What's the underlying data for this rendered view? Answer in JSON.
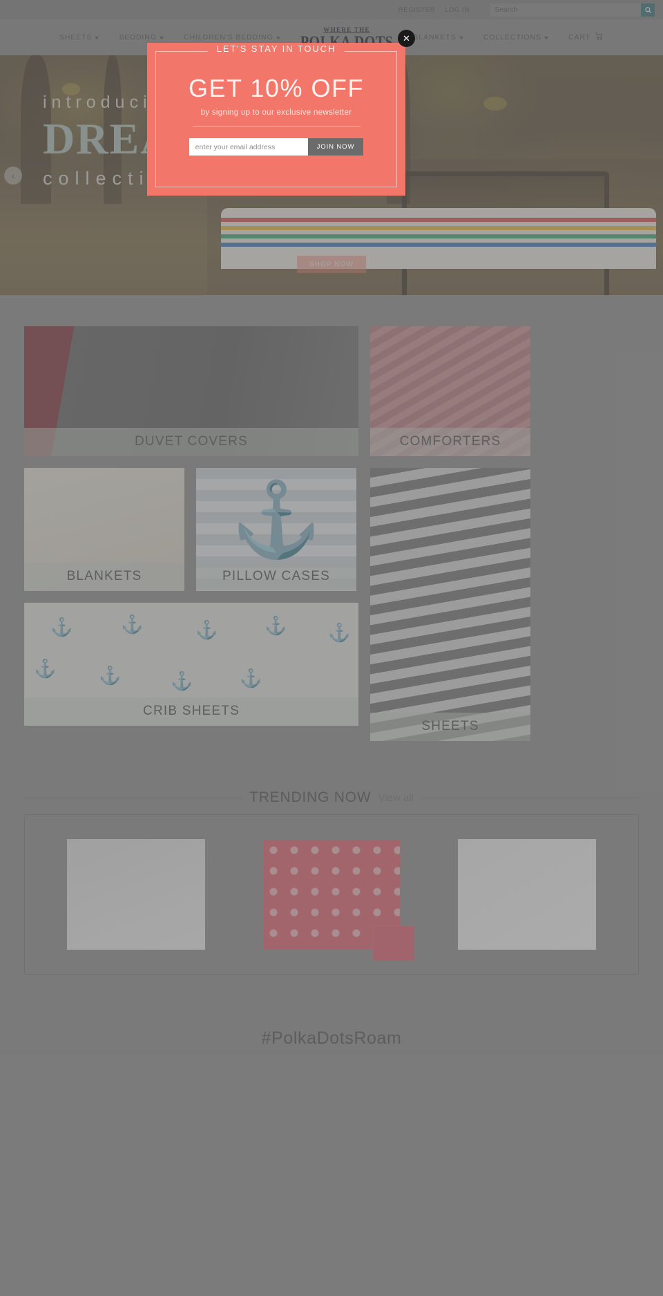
{
  "utility": {
    "register_label": "REGISTER",
    "login_label": "LOG IN",
    "search_placeholder": "Search",
    "search_value": ""
  },
  "nav": {
    "items": [
      {
        "label": "SHEETS",
        "has_dropdown": true
      },
      {
        "label": "BEDDING",
        "has_dropdown": true
      },
      {
        "label": "CHILDREN'S BEDDING",
        "has_dropdown": true
      },
      {
        "label": "BLANKETS",
        "has_dropdown": true
      },
      {
        "label": "COLLECTIONS",
        "has_dropdown": true
      }
    ],
    "logo_top": "WHERE THE",
    "logo_main": "POLKA DOTS",
    "cart_label": "CART"
  },
  "hero": {
    "intro": "introducing",
    "title": "DREAM",
    "subtitle": "collection",
    "shop_now_label": "SHOP NOW",
    "prev_arrow": "‹"
  },
  "categories": [
    {
      "label": "DUVET COVERS",
      "id": "duvet-covers"
    },
    {
      "label": "COMFORTERS",
      "id": "comforters"
    },
    {
      "label": "BLANKETS",
      "id": "blankets"
    },
    {
      "label": "PILLOW CASES",
      "id": "pillow-cases"
    },
    {
      "label": "SHEETS",
      "id": "sheets"
    },
    {
      "label": "CRIB SHEETS",
      "id": "crib-sheets"
    }
  ],
  "trending": {
    "title": "TRENDING NOW",
    "view_all_label": "View all"
  },
  "footer": {
    "hashtag": "#PolkaDotsRoam"
  },
  "modal": {
    "kicker": "LET'S STAY IN TOUCH",
    "headline": "GET 10% OFF",
    "subtext": "by signing up to our exclusive newsletter",
    "email_placeholder": "enter your email address",
    "email_value": "",
    "join_label": "JOIN NOW",
    "close_glyph": "✕"
  },
  "colors": {
    "modal_bg": "#f2776a",
    "accent_teal": "#2e6f74",
    "page_bg": "#8a8a8a",
    "join_btn": "#6b6b6b"
  }
}
